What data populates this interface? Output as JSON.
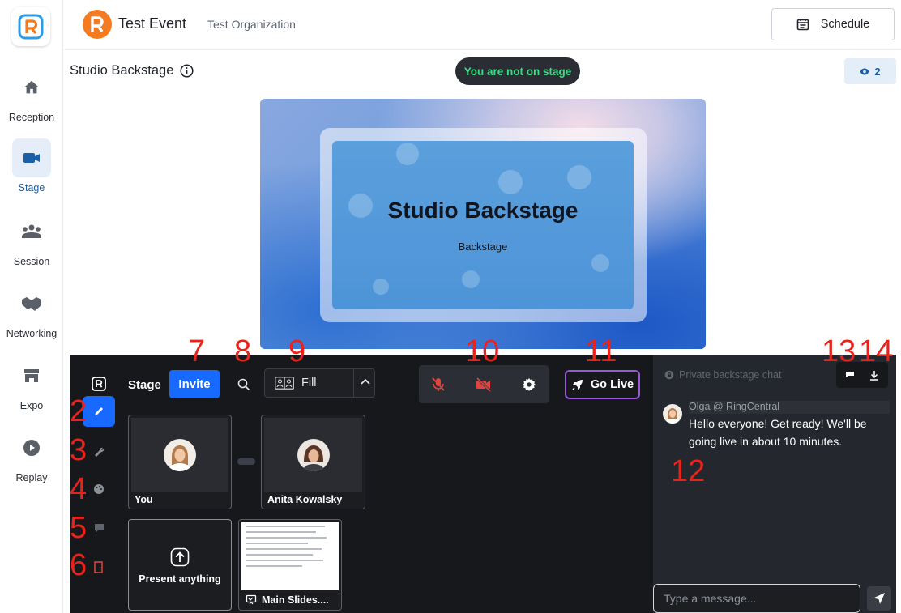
{
  "header": {
    "event_title": "Test Event",
    "organization": "Test Organization",
    "schedule_label": "Schedule"
  },
  "nav": {
    "items": [
      {
        "label": "Reception",
        "icon": "home-icon",
        "active": false
      },
      {
        "label": "Stage",
        "icon": "video-camera-icon",
        "active": true
      },
      {
        "label": "Session",
        "icon": "group-icon",
        "active": false
      },
      {
        "label": "Networking",
        "icon": "handshake-icon",
        "active": false
      },
      {
        "label": "Expo",
        "icon": "store-icon",
        "active": false
      },
      {
        "label": "Replay",
        "icon": "play-circle-icon",
        "active": false
      }
    ]
  },
  "backstage": {
    "title": "Studio Backstage",
    "stage_status": "You are not on stage",
    "viewer_count": "2"
  },
  "preview": {
    "heading": "Studio Backstage",
    "subheading": "Backstage"
  },
  "annotations": [
    "2",
    "3",
    "4",
    "5",
    "6",
    "7",
    "8",
    "9",
    "10",
    "11",
    "12",
    "13",
    "14"
  ],
  "studio": {
    "stage_label": "Stage",
    "invite_label": "Invite",
    "layout_value": "Fill",
    "go_live_label": "Go Live",
    "participants": [
      {
        "name": "You"
      },
      {
        "name": "Anita Kowalsky"
      }
    ],
    "present_label": "Present anything",
    "slides_label": "Main Slides...."
  },
  "chat": {
    "header": "Private backstage chat",
    "messages": [
      {
        "from": "Olga @ RingCentral",
        "text": "Hello everyone! Get ready! We'll be going live in about 10 minutes."
      }
    ],
    "input_placeholder": "Type a message..."
  },
  "colors": {
    "brand_blue": "#1a5fa8",
    "invite_blue": "#1769ff",
    "live_green": "#3ddc84",
    "annotation_red": "#e8231c",
    "mute_red": "#e0443e"
  }
}
